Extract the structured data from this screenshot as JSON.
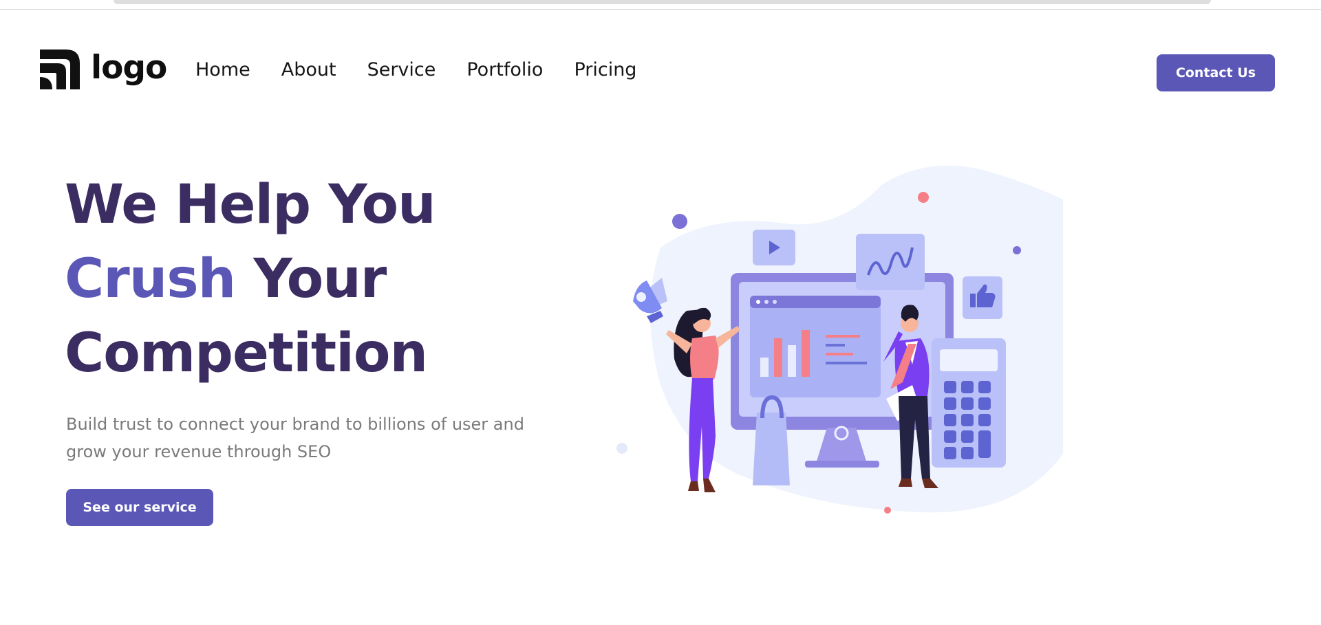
{
  "navbar": {
    "logo_text": "logo",
    "links": [
      "Home",
      "About",
      "Service",
      "Portfolio",
      "Pricing"
    ],
    "contact_label": "Contact Us"
  },
  "hero": {
    "title_line1": "We Help You",
    "title_line2_accent": "Crush",
    "title_line2_rest": " Your",
    "title_line3": "Competition",
    "subtitle": "Build trust to connect your brand to billions of user and grow your revenue through SEO",
    "cta_label": "See our service"
  },
  "colors": {
    "accent": "#5b57b6",
    "title": "#3b2d62",
    "subtitle": "#7a7a7a"
  },
  "icons": [
    "logo-icon",
    "megaphone-icon",
    "play-icon",
    "thumbs-up-icon",
    "chart-icon"
  ]
}
